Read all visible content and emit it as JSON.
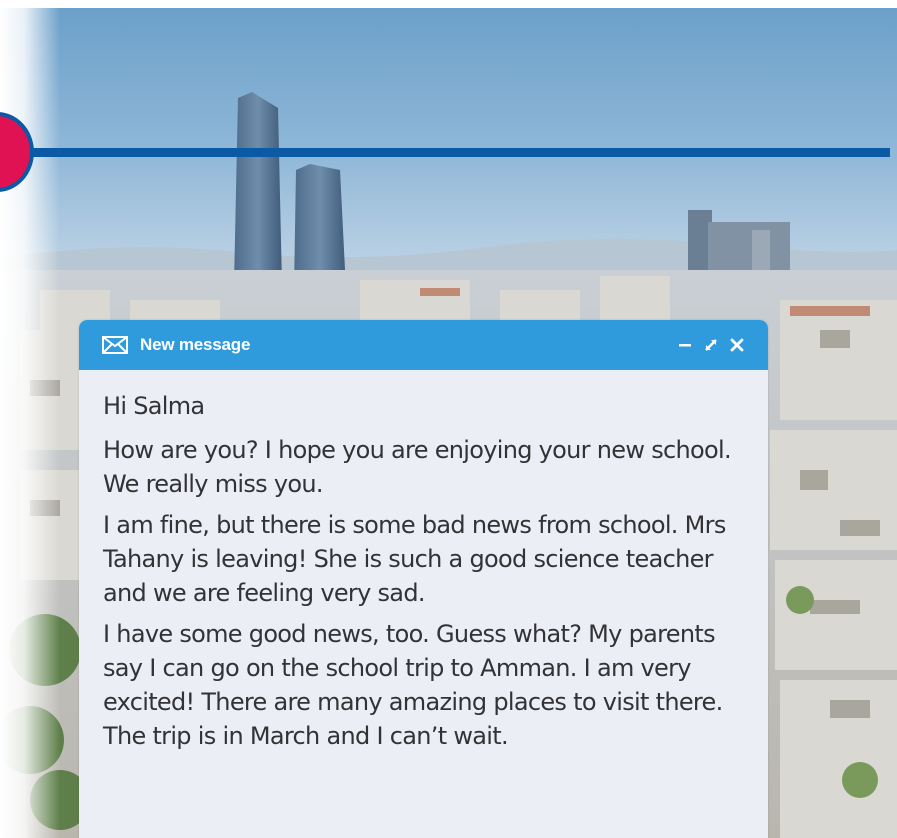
{
  "window": {
    "title": "New message",
    "icons": [
      "envelope-icon",
      "minimize-icon",
      "expand-icon",
      "close-icon"
    ]
  },
  "message": {
    "greeting": "Hi Salma",
    "paragraphs": [
      "How are you? I hope you are enjoying your new school. We really miss you.",
      "I am fine, but there is some bad news from school. Mrs Tahany is leaving! She is such a good science teacher and we are feeling very sad.",
      "I have some good news, too. Guess what? My parents say I can go on the school trip to Amman. I am very excited! There are many amazing places to visit there. The trip is in March and I can’t wait."
    ]
  },
  "colors": {
    "titlebar": "#2f9bdc",
    "message_bg": "#eceef6",
    "timeline_line": "#0a5aa6",
    "marker": "#e01253"
  }
}
